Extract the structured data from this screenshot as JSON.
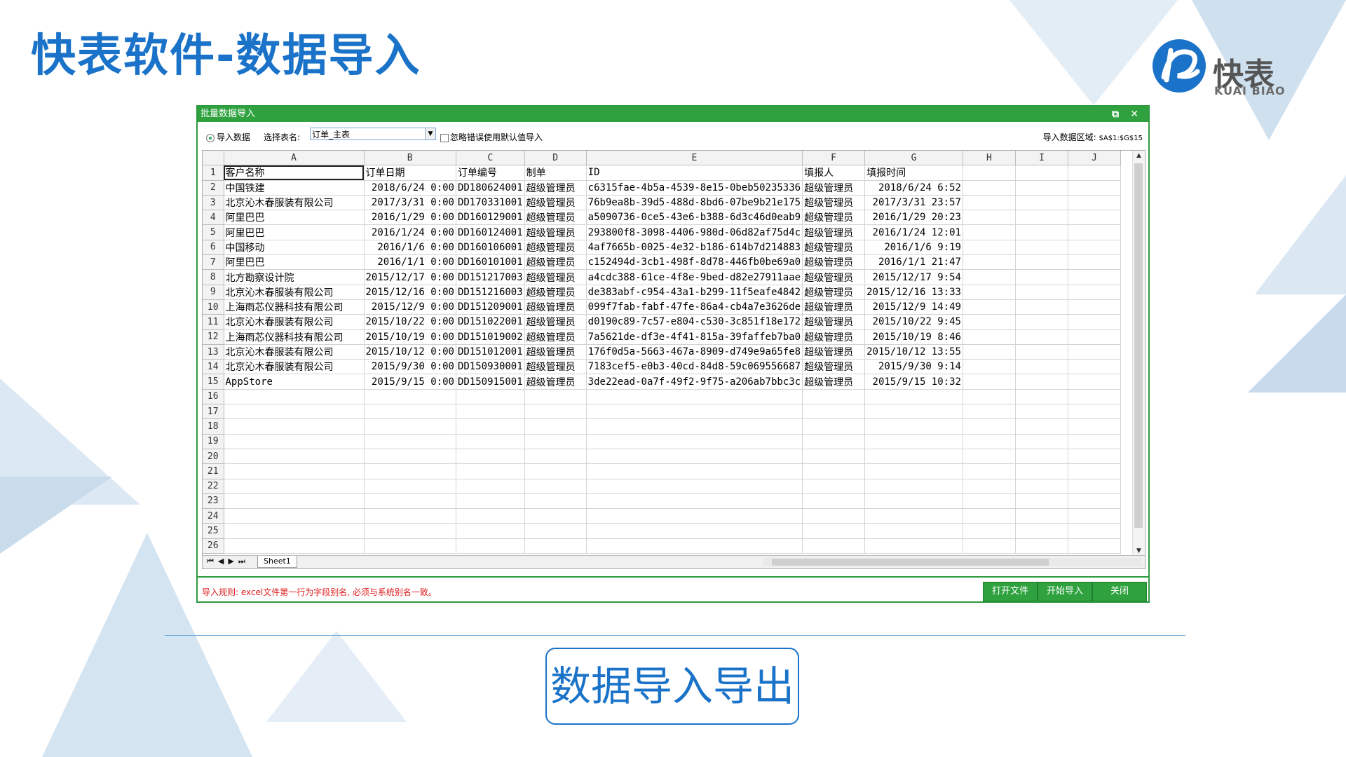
{
  "page": {
    "title": "快表软件-数据导入",
    "logo_text": "快表",
    "logo_sub": "KUAI BIAO",
    "bottom_label": "数据导入导出",
    "accent": "#1a73c8",
    "window_green": "#2fa23f"
  },
  "window": {
    "title": "批量数据导入",
    "restore_icon": "restore-icon",
    "close_icon": "close-icon",
    "restore_glyph": "⧉",
    "close_glyph": "✕",
    "radio_label": "导入数据",
    "select_label": "选择表名:",
    "select_value": "订单_主表",
    "checkbox_label": "忽略错误使用默认值导入",
    "range_label": "导入数据区域:",
    "range_value": "$A$1:$G$15",
    "sheet_tab": "Sheet1",
    "rule_text": "导入规则: excel文件第一行为字段别名, 必须与系统别名一致。",
    "buttons": {
      "open": "打开文件",
      "start": "开始导入",
      "close": "关闭"
    }
  },
  "sheet": {
    "columns": [
      "A",
      "B",
      "C",
      "D",
      "E",
      "F",
      "G",
      "H",
      "I",
      "J"
    ],
    "rows": [
      [
        "客户名称",
        "订单日期",
        "订单编号",
        "制单",
        "ID",
        "填报人",
        "填报时间"
      ],
      [
        "中国铁建",
        "2018/6/24 0:00",
        "DD180624001",
        "超级管理员",
        "c6315fae-4b5a-4539-8e15-0beb50235336",
        "超级管理员",
        "2018/6/24 6:52"
      ],
      [
        "北京沁木春服装有限公司",
        "2017/3/31 0:00",
        "DD170331001",
        "超级管理员",
        "76b9ea8b-39d5-488d-8bd6-07be9b21e175",
        "超级管理员",
        "2017/3/31 23:57"
      ],
      [
        "阿里巴巴",
        "2016/1/29 0:00",
        "DD160129001",
        "超级管理员",
        "a5090736-0ce5-43e6-b388-6d3c46d0eab9",
        "超级管理员",
        "2016/1/29 20:23"
      ],
      [
        "阿里巴巴",
        "2016/1/24 0:00",
        "DD160124001",
        "超级管理员",
        "293800f8-3098-4406-980d-06d82af75d4c",
        "超级管理员",
        "2016/1/24 12:01"
      ],
      [
        "中国移动",
        "2016/1/6 0:00",
        "DD160106001",
        "超级管理员",
        "4af7665b-0025-4e32-b186-614b7d214883",
        "超级管理员",
        "2016/1/6 9:19"
      ],
      [
        "阿里巴巴",
        "2016/1/1 0:00",
        "DD160101001",
        "超级管理员",
        "c152494d-3cb1-498f-8d78-446fb0be69a0",
        "超级管理员",
        "2016/1/1 21:47"
      ],
      [
        "北方勘察设计院",
        "2015/12/17 0:00",
        "DD151217003",
        "超级管理员",
        "a4cdc388-61ce-4f8e-9bed-d82e27911aae",
        "超级管理员",
        "2015/12/17 9:54"
      ],
      [
        "北京沁木春服装有限公司",
        "2015/12/16 0:00",
        "DD151216003",
        "超级管理员",
        "de383abf-c954-43a1-b299-11f5eafe4842",
        "超级管理员",
        "2015/12/16 13:33"
      ],
      [
        "上海雨芯仪器科技有限公司",
        "2015/12/9 0:00",
        "DD151209001",
        "超级管理员",
        "099f7fab-fabf-47fe-86a4-cb4a7e3626de",
        "超级管理员",
        "2015/12/9 14:49"
      ],
      [
        "北京沁木春服装有限公司",
        "2015/10/22 0:00",
        "DD151022001",
        "超级管理员",
        "d0190c89-7c57-e804-c530-3c851f18e172",
        "超级管理员",
        "2015/10/22 9:45"
      ],
      [
        "上海雨芯仪器科技有限公司",
        "2015/10/19 0:00",
        "DD151019002",
        "超级管理员",
        "7a5621de-df3e-4f41-815a-39faffeb7ba0",
        "超级管理员",
        "2015/10/19 8:46"
      ],
      [
        "北京沁木春服装有限公司",
        "2015/10/12 0:00",
        "DD151012001",
        "超级管理员",
        "176f0d5a-5663-467a-8909-d749e9a65fe8",
        "超级管理员",
        "2015/10/12 13:55"
      ],
      [
        "北京沁木春服装有限公司",
        "2015/9/30 0:00",
        "DD150930001",
        "超级管理员",
        "7183cef5-e0b3-40cd-84d8-59c069556687",
        "超级管理员",
        "2015/9/30 9:14"
      ],
      [
        "AppStore",
        "2015/9/15 0:00",
        "DD150915001",
        "超级管理员",
        "3de22ead-0a7f-49f2-9f75-a206ab7bbc3c",
        "超级管理员",
        "2015/9/15 10:32"
      ]
    ],
    "total_rows": 26
  }
}
